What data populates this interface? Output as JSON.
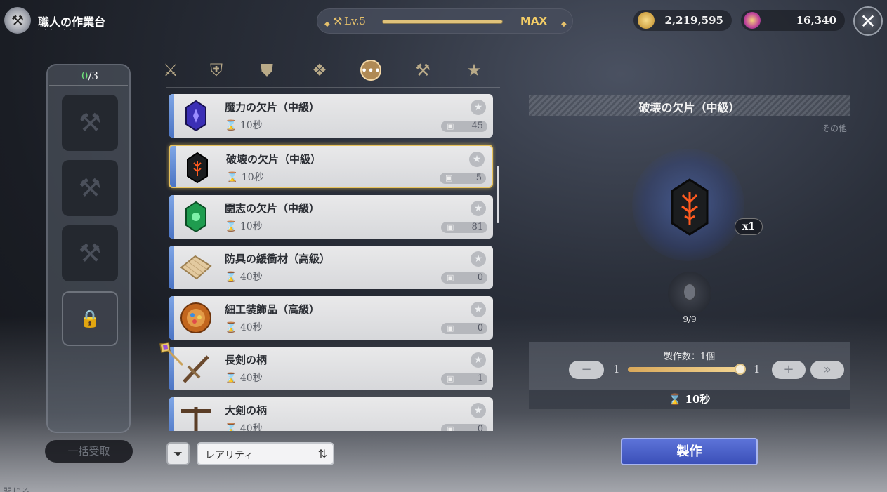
{
  "header": {
    "title": "職人の作業台",
    "level_label": "Lv.5",
    "max_label": "MAX",
    "currencies": [
      {
        "icon": "gold-coin-icon",
        "value": "2,219,595"
      },
      {
        "icon": "star-gem-icon",
        "value": "16,340"
      }
    ]
  },
  "queue": {
    "count_used": "0",
    "count_total": "/3",
    "bulk_receive_label": "一括受取"
  },
  "categories": [
    {
      "icon": "weapon-category-icon"
    },
    {
      "icon": "shield-category-icon"
    },
    {
      "icon": "armor-category-icon"
    },
    {
      "icon": "accessory-category-icon"
    },
    {
      "icon": "other-category-icon",
      "active": true
    },
    {
      "icon": "tool-category-icon"
    },
    {
      "icon": "favorite-star-icon"
    }
  ],
  "recipes": [
    {
      "name": "魔力の欠片（中級）",
      "time": "10秒",
      "stock": "45",
      "icon": "magic-shard-icon",
      "color": "#3b2fb5"
    },
    {
      "name": "破壊の欠片（中級）",
      "time": "10秒",
      "stock": "5",
      "icon": "destruction-shard-icon",
      "color": "#1b1d1f",
      "selected": true
    },
    {
      "name": "闘志の欠片（中級）",
      "time": "10秒",
      "stock": "81",
      "icon": "fighting-spirit-shard-icon",
      "color": "#1f9c4f"
    },
    {
      "name": "防具の緩衝材（高級）",
      "time": "40秒",
      "stock": "0",
      "icon": "armor-cushion-icon",
      "color": "#e3caa0"
    },
    {
      "name": "細工装飾品（高級）",
      "time": "40秒",
      "stock": "0",
      "icon": "ornament-icon",
      "color": "#c2661e"
    },
    {
      "name": "長剣の柄",
      "time": "40秒",
      "stock": "1",
      "icon": "long-sword-hilt-icon",
      "color": "#6b4a2e"
    },
    {
      "name": "大剣の柄",
      "time": "40秒",
      "stock": "0",
      "icon": "great-sword-hilt-icon",
      "color": "#5a3d26"
    }
  ],
  "filter": {
    "sort_label": "レアリティ"
  },
  "detail": {
    "title": "破壊の欠片（中級）",
    "category": "その他",
    "quantity_badge": "x1",
    "material_count": "9/9",
    "craft_count_label": "製作数：1個",
    "qty_min": "1",
    "qty_max": "1",
    "qty_fraction": 1.0,
    "time": "10秒",
    "craft_label": "製作"
  },
  "footer": {
    "label": "閉じる"
  }
}
